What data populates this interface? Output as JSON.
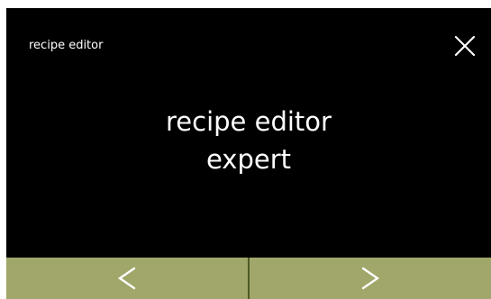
{
  "header": {
    "title": "recipe editor",
    "close_icon": "close-icon"
  },
  "main": {
    "line1": "recipe editor",
    "line2": "expert"
  },
  "footer": {
    "prev_icon": "chevron-left-icon",
    "next_icon": "chevron-right-icon",
    "button_color": "#a1a66a",
    "divider_color": "#4f5a26"
  },
  "colors": {
    "background": "#000000",
    "text": "#ffffff"
  }
}
